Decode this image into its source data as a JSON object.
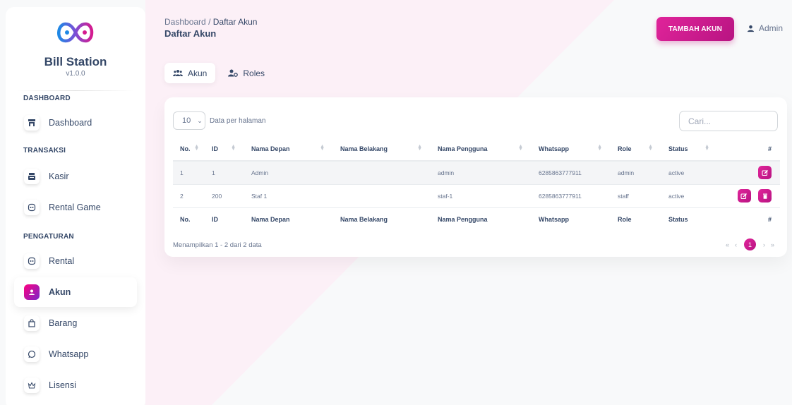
{
  "brand": {
    "name": "Bill Station",
    "version": "v1.0.0"
  },
  "sidebar": {
    "sections": [
      {
        "label": "DASHBOARD"
      },
      {
        "label": "TRANSAKSI"
      },
      {
        "label": "PENGATURAN"
      }
    ],
    "items": [
      {
        "label": "Dashboard",
        "icon": "store-icon"
      },
      {
        "label": "Kasir",
        "icon": "cash-register-icon"
      },
      {
        "label": "Rental Game",
        "icon": "gamepad-icon"
      },
      {
        "label": "Rental",
        "icon": "gamepad-icon"
      },
      {
        "label": "Akun",
        "icon": "user-circle-icon",
        "active": true
      },
      {
        "label": "Barang",
        "icon": "shopping-bag-icon"
      },
      {
        "label": "Whatsapp",
        "icon": "whatsapp-icon"
      },
      {
        "label": "Lisensi",
        "icon": "crown-icon"
      }
    ]
  },
  "header": {
    "breadcrumb_parent": "Dashboard",
    "breadcrumb_sep": "/",
    "breadcrumb_current": "Daftar Akun",
    "title": "Daftar Akun",
    "add_button": "TAMBAH AKUN",
    "user": "Admin"
  },
  "tabs": [
    {
      "label": "Akun",
      "active": true
    },
    {
      "label": "Roles",
      "active": false
    }
  ],
  "table": {
    "per_page_value": "10",
    "per_page_label": "Data per halaman",
    "search_placeholder": "Cari...",
    "columns": [
      "No.",
      "ID",
      "Nama Depan",
      "Nama Belakang",
      "Nama Pengguna",
      "Whatsapp",
      "Role",
      "Status",
      "#"
    ],
    "rows": [
      {
        "no": "1",
        "id": "1",
        "nama_depan": "Admin",
        "nama_belakang": "",
        "nama_pengguna": "admin",
        "whatsapp": "6285863777911",
        "role": "admin",
        "status": "active"
      },
      {
        "no": "2",
        "id": "200",
        "nama_depan": "Staf 1",
        "nama_belakang": "",
        "nama_pengguna": "staf-1",
        "whatsapp": "6285863777911",
        "role": "staff",
        "status": "active"
      }
    ],
    "info": "Menampilkan 1 - 2 dari 2 data",
    "pagination": {
      "first": "«",
      "prev": "‹",
      "current": "1",
      "next": "›",
      "last": "»"
    }
  },
  "colors": {
    "accent": "#d41b8f",
    "sidebar_bg": "#ffffff",
    "page_bg": "#f8f9fa",
    "bg_shape": "#fbeef6"
  }
}
